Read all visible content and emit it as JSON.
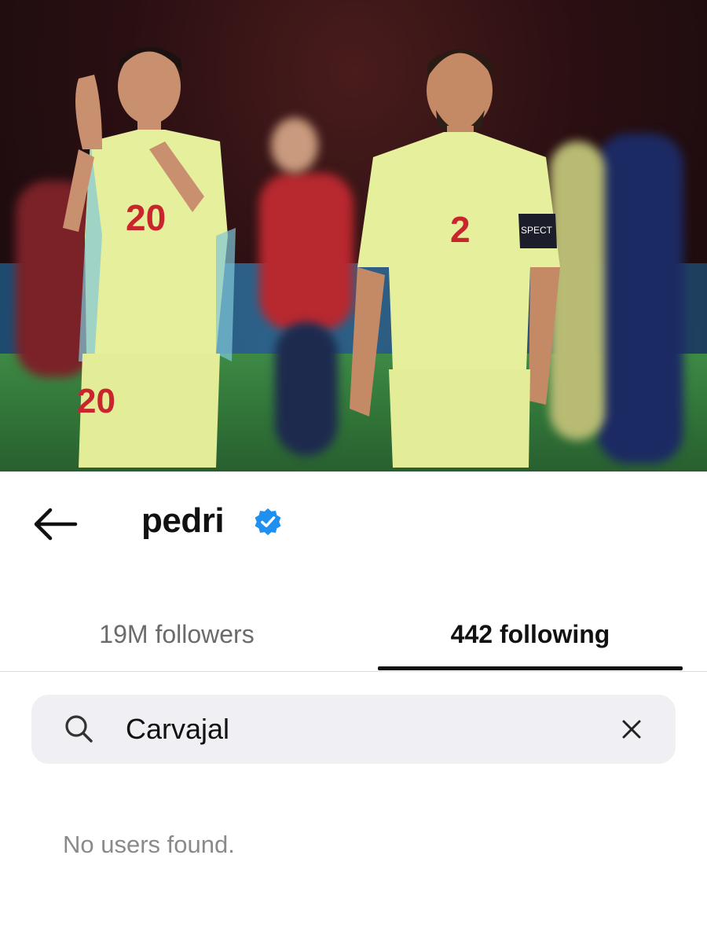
{
  "header": {
    "username": "pedri",
    "verified": true,
    "back_icon": "arrow-left-icon"
  },
  "photo": {
    "player_left_number": "20",
    "player_right_number": "2",
    "armband_text": "SPECT"
  },
  "tabs": [
    {
      "label": "19M followers",
      "active": false
    },
    {
      "label": "442 following",
      "active": true
    }
  ],
  "search": {
    "value": "Carvajal",
    "icon": "search-icon",
    "clear_icon": "close-icon"
  },
  "results": {
    "empty_message": "No users found."
  },
  "colors": {
    "verified_blue": "#1f8ff0",
    "search_bg": "#efeff4",
    "muted_text": "#8a8a8a",
    "jersey": "#e6ef9b",
    "jersey_accent": "#c8262c"
  }
}
